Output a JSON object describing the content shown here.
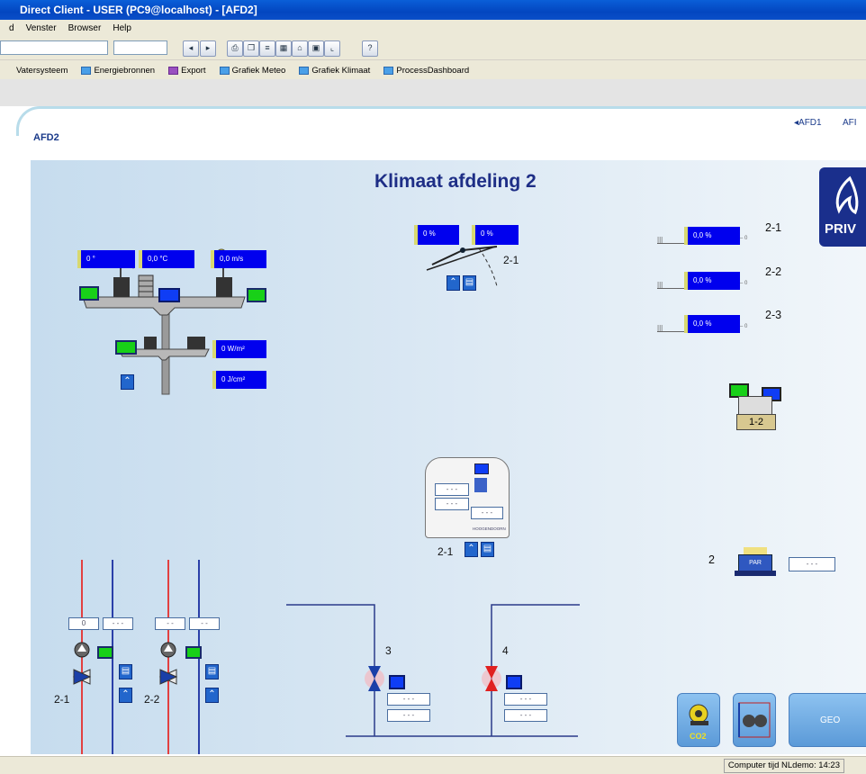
{
  "window": {
    "title": "Direct Client - USER (PC9@localhost) - [AFD2]"
  },
  "menu": {
    "items": [
      "d",
      "Venster",
      "Browser",
      "Help"
    ]
  },
  "quicklinks": [
    "Vatersysteem",
    "Energiebronnen",
    "Export",
    "Grafiek Meteo",
    "Grafiek Klimaat",
    "ProcessDashboard"
  ],
  "nav": {
    "prev": "◂AFD1",
    "next": "AFI"
  },
  "page": {
    "section": "AFD2",
    "title": "Klimaat afdeling 2",
    "logo_text": "PRIV"
  },
  "weather": {
    "wind_direction": "0 °",
    "temperature": "0,0 °C",
    "wind_speed": "0,0 m/s",
    "radiation": "0 W/m²",
    "radiation_sum": "0 J/cm²"
  },
  "window_vent": {
    "left": "0 %",
    "right": "0 %",
    "label": "2-1"
  },
  "screens": [
    {
      "label": "2-1",
      "value": "0,0 %"
    },
    {
      "label": "2-2",
      "value": "0,0 %"
    },
    {
      "label": "2-3",
      "value": "0,0 %"
    }
  ],
  "screen_scale_end": "– 0",
  "device_12": {
    "label": "1-2"
  },
  "climate_box": {
    "label": "2-1",
    "value1": "- - -",
    "value2": "- - -",
    "value3": "- - -",
    "brand": "HOOGENDOORN"
  },
  "par": {
    "label": "2",
    "sensor": "PAR",
    "value": "- - -"
  },
  "heating": [
    {
      "label": "2-1",
      "val1": "0",
      "val2": "- - -"
    },
    {
      "label": "2-2",
      "val1": "- -",
      "val2": "- -"
    }
  ],
  "valves": [
    {
      "label": "3",
      "val1": "- - -",
      "val2": "- - -"
    },
    {
      "label": "4",
      "val1": "- - -",
      "val2": "- - -"
    }
  ],
  "bottom_buttons": {
    "co2": "CO2",
    "geo": "GEO"
  },
  "status": {
    "computer_time": "Computer tijd NLdemo: 14:23"
  }
}
